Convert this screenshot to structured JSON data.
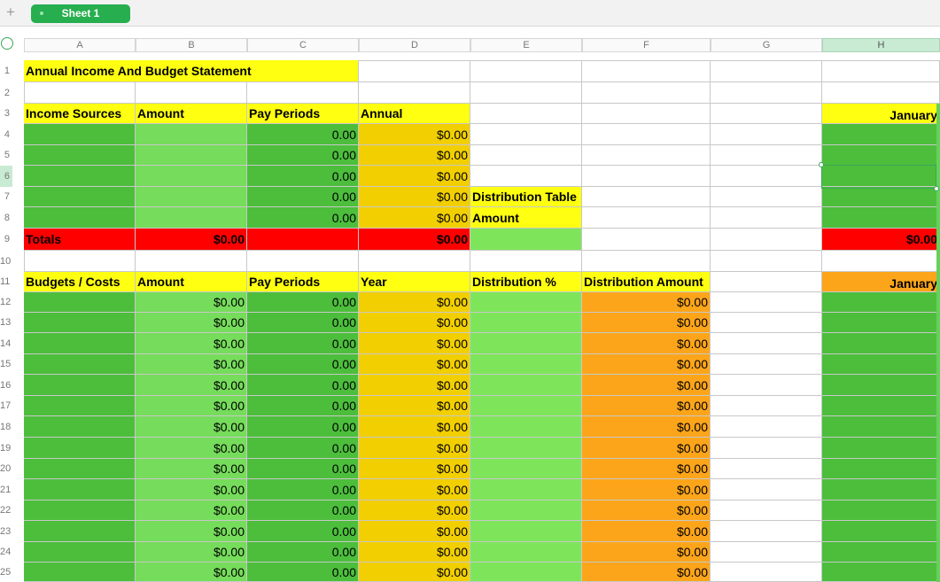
{
  "tabbar": {
    "add_label": "+",
    "sheet_name": "Sheet 1"
  },
  "columns": [
    "A",
    "B",
    "C",
    "D",
    "E",
    "F",
    "G",
    "H"
  ],
  "selected_column": "H",
  "rows": [
    "1",
    "2",
    "3",
    "4",
    "5",
    "6",
    "7",
    "8",
    "9",
    "10",
    "11",
    "12",
    "13",
    "14",
    "15",
    "16",
    "17",
    "18",
    "19",
    "20",
    "21",
    "22",
    "23",
    "24",
    "25"
  ],
  "selected_row": "6",
  "colors": {
    "yellow": "#ffff11",
    "dark_green": "#4cbe3c",
    "light_green": "#76dc5b",
    "bright_green": "#7ee55b",
    "gold": "#f2cf00",
    "red": "#ff0000",
    "orange": "#fda51a",
    "selection": "#3aa757"
  },
  "income": {
    "title": "Annual Income And Budget Statement",
    "headers": [
      "Income Sources",
      "Amount",
      "Pay Periods",
      "Annual"
    ],
    "rows": [
      [
        "",
        "",
        "0.00",
        "$0.00"
      ],
      [
        "",
        "",
        "0.00",
        "$0.00"
      ],
      [
        "",
        "",
        "0.00",
        "$0.00"
      ],
      [
        "",
        "",
        "0.00",
        "$0.00"
      ],
      [
        "",
        "",
        "0.00",
        "$0.00"
      ]
    ],
    "totals": [
      "Totals",
      "$0.00",
      "",
      "$0.00"
    ]
  },
  "distribution": {
    "table_label": "Distribution Table",
    "amount_label": "Amount"
  },
  "month_income": {
    "header": "January",
    "total": "$0.00"
  },
  "budgets": {
    "headers": [
      "Budgets / Costs",
      "Amount",
      "Pay Periods",
      "Year",
      "Distribution %",
      "Distribution Amount"
    ],
    "rows": [
      [
        "",
        "$0.00",
        "0.00",
        "$0.00",
        "",
        "$0.00"
      ],
      [
        "",
        "$0.00",
        "0.00",
        "$0.00",
        "",
        "$0.00"
      ],
      [
        "",
        "$0.00",
        "0.00",
        "$0.00",
        "",
        "$0.00"
      ],
      [
        "",
        "$0.00",
        "0.00",
        "$0.00",
        "",
        "$0.00"
      ],
      [
        "",
        "$0.00",
        "0.00",
        "$0.00",
        "",
        "$0.00"
      ],
      [
        "",
        "$0.00",
        "0.00",
        "$0.00",
        "",
        "$0.00"
      ],
      [
        "",
        "$0.00",
        "0.00",
        "$0.00",
        "",
        "$0.00"
      ],
      [
        "",
        "$0.00",
        "0.00",
        "$0.00",
        "",
        "$0.00"
      ],
      [
        "",
        "$0.00",
        "0.00",
        "$0.00",
        "",
        "$0.00"
      ],
      [
        "",
        "$0.00",
        "0.00",
        "$0.00",
        "",
        "$0.00"
      ],
      [
        "",
        "$0.00",
        "0.00",
        "$0.00",
        "",
        "$0.00"
      ],
      [
        "",
        "$0.00",
        "0.00",
        "$0.00",
        "",
        "$0.00"
      ],
      [
        "",
        "$0.00",
        "0.00",
        "$0.00",
        "",
        "$0.00"
      ],
      [
        "",
        "$0.00",
        "0.00",
        "$0.00",
        "",
        "$0.00"
      ]
    ],
    "month_header": "January"
  }
}
